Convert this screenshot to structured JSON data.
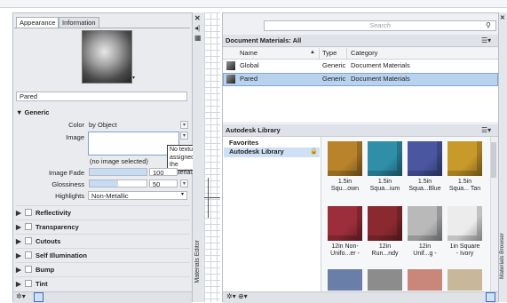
{
  "left_panel": {
    "tabs": [
      "Appearance",
      "Information"
    ],
    "material_name": "Pared",
    "generic_section": "Generic",
    "color_label": "Color",
    "color_value": "by Object",
    "image_label": "Image",
    "image_caption": "(no image selected)",
    "image_fade_label": "Image Fade",
    "image_fade_value": "100",
    "image_fade_level": 1.0,
    "glossiness_label": "Glossiness",
    "glossiness_value": "50",
    "glossiness_level": 0.5,
    "highlights_label": "Highlights",
    "highlights_value": "Non-Metallic",
    "tooltip": [
      "No texture is",
      "assigned to the",
      "material."
    ],
    "sections": [
      "Reflectivity",
      "Transparency",
      "Cutouts",
      "Self Illumination",
      "Bump",
      "Tint"
    ],
    "side_label": "Materials Editor"
  },
  "right_panel": {
    "search_placeholder": "Search",
    "doc_materials_title": "Document Materials: All",
    "columns": [
      "Name",
      "Type",
      "Category"
    ],
    "rows": [
      {
        "name": "Global",
        "type": "Generic",
        "category": "Document Materials"
      },
      {
        "name": "Pared",
        "type": "Generic",
        "category": "Document Materials"
      }
    ],
    "library_title": "Autodesk Library",
    "tree": [
      "Favorites",
      "Autodesk Library"
    ],
    "swatches": [
      {
        "label": [
          "1.5in",
          "Squ...own"
        ],
        "color": "#b8832a"
      },
      {
        "label": [
          "1.5in",
          "Squa...ium"
        ],
        "color": "#2f8fa8"
      },
      {
        "label": [
          "1.5in",
          "Squa...Blue"
        ],
        "color": "#4a57a0"
      },
      {
        "label": [
          "1.5in",
          "Squa... Tan"
        ],
        "color": "#c79a2a"
      },
      {
        "label": [
          "12in Non-",
          "Unifo...er -"
        ],
        "color": "#9b2e3a"
      },
      {
        "label": [
          "12in",
          "Run...ndy"
        ],
        "color": "#8a2a30"
      },
      {
        "label": [
          "12in",
          "Unif...g -"
        ],
        "color": "#b9b9b9"
      },
      {
        "label": [
          "1in Square",
          "- Ivory"
        ],
        "color": "#ececec"
      }
    ],
    "side_label": "Materials Browser"
  }
}
